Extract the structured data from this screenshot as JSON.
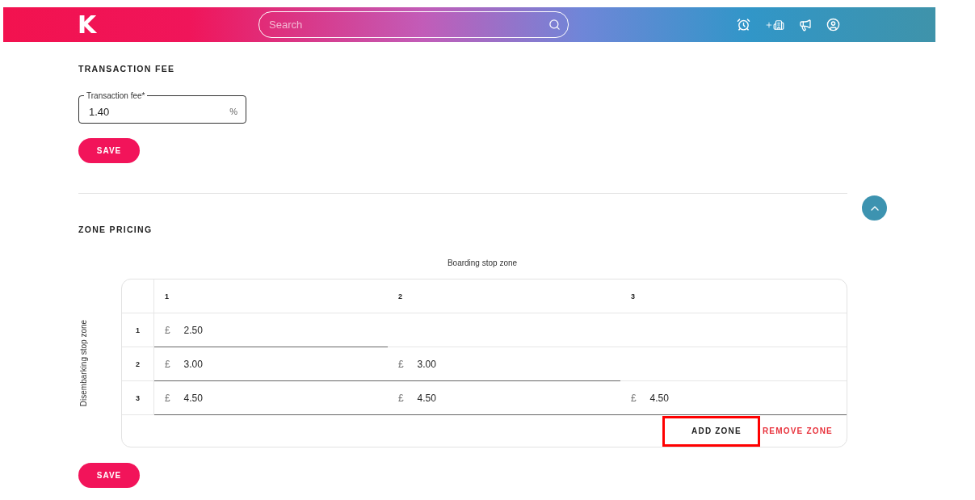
{
  "header": {
    "logo": "K",
    "search": {
      "placeholder": "Search"
    }
  },
  "transaction_fee": {
    "title": "TRANSACTION FEE",
    "field": {
      "label": "Transaction fee",
      "required_mark": "*",
      "value": "1.40",
      "unit": "%"
    },
    "save": "SAVE"
  },
  "zone_pricing": {
    "title": "ZONE PRICING",
    "column_axis": "Boarding stop zone",
    "row_axis": "Disembarking stop zone",
    "columns": [
      "1",
      "2",
      "3"
    ],
    "rows": [
      {
        "label": "1",
        "cells": [
          {
            "currency": "£",
            "value": "2.50"
          }
        ]
      },
      {
        "label": "2",
        "cells": [
          {
            "currency": "£",
            "value": "3.00"
          },
          {
            "currency": "£",
            "value": "3.00"
          }
        ]
      },
      {
        "label": "3",
        "cells": [
          {
            "currency": "£",
            "value": "4.50"
          },
          {
            "currency": "£",
            "value": "4.50"
          },
          {
            "currency": "£",
            "value": "4.50"
          }
        ]
      }
    ],
    "actions": [
      {
        "label": "ADD ZONE",
        "kind": "primary",
        "highlighted": true
      },
      {
        "label": "REMOVE ZONE",
        "kind": "danger",
        "highlighted": false
      }
    ],
    "save": "SAVE"
  }
}
